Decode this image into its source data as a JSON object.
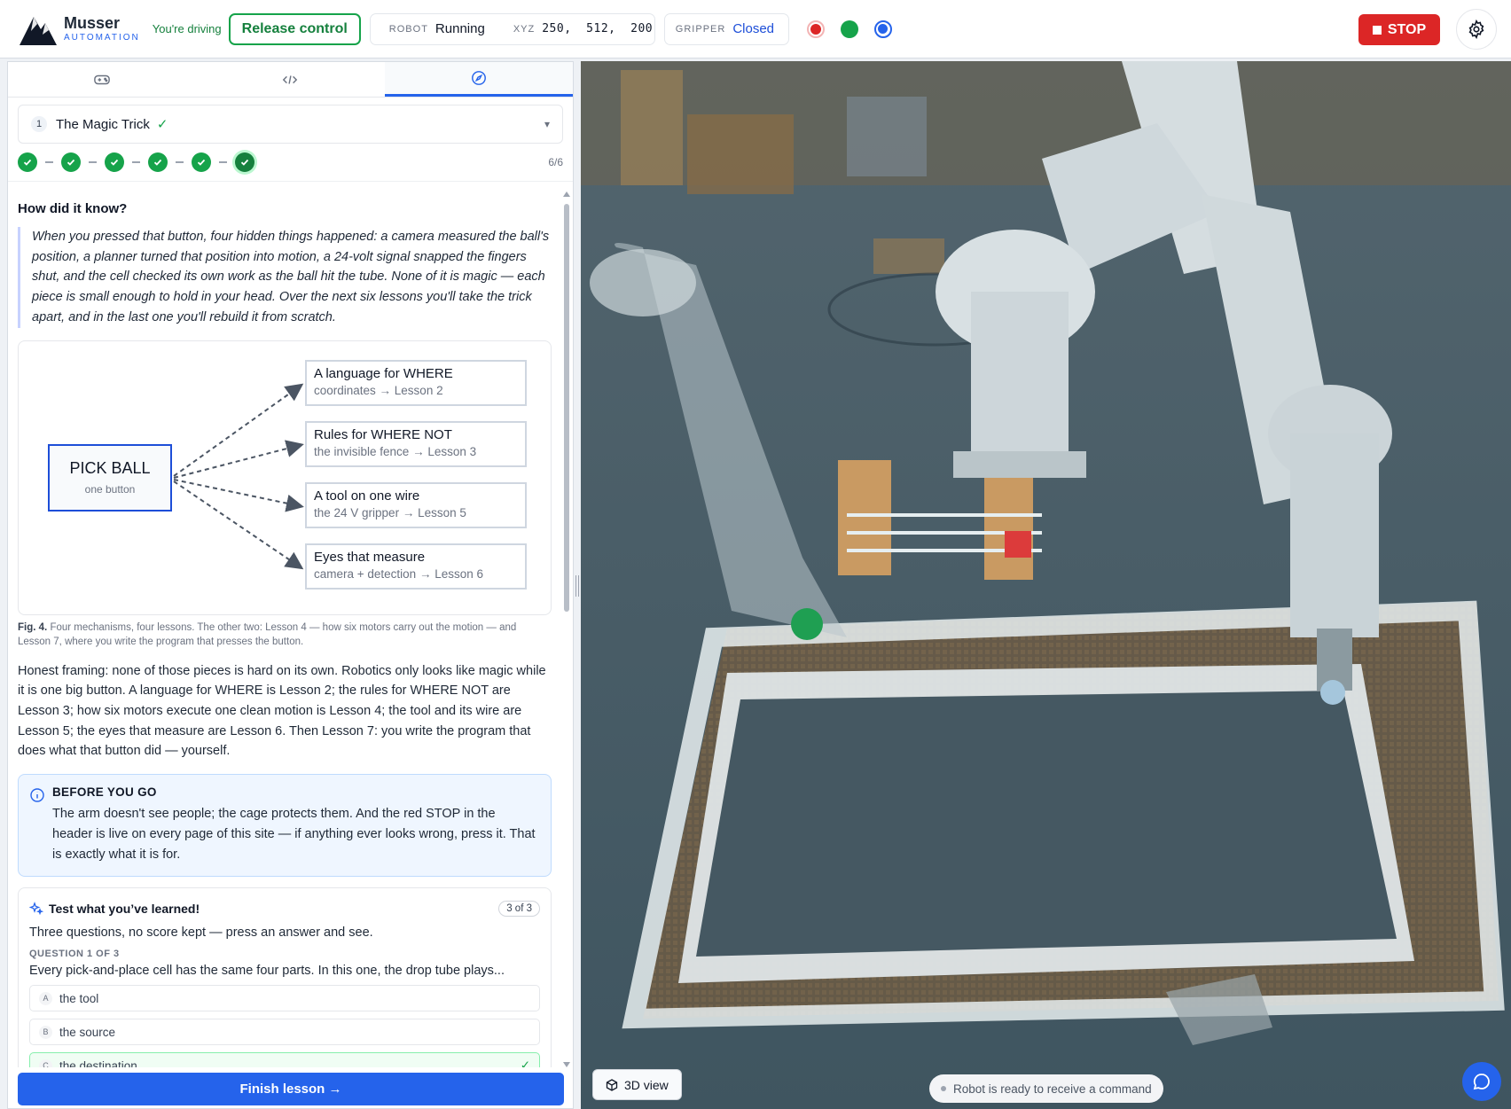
{
  "header": {
    "brand_name": "Musser",
    "brand_sub": "AUTOMATION",
    "driving_text": "You're driving",
    "release_label": "Release control",
    "robot_label": "ROBOT",
    "robot_state": "Running",
    "xyz_label": "XYZ",
    "xyz_value": "250,  512,  200",
    "gripper_label": "GRIPPER",
    "gripper_state": "Closed",
    "indicators": [
      "record-icon",
      "status-green-icon",
      "camera-blue-icon"
    ],
    "stop_label": "STOP",
    "colors": {
      "stop": "#dc2626",
      "running": "#16a34a",
      "accent": "#2563eb"
    }
  },
  "tabs": [
    {
      "icon": "gamepad-icon",
      "active": false
    },
    {
      "icon": "code-icon",
      "active": false
    },
    {
      "icon": "compass-icon",
      "active": true
    }
  ],
  "lesson": {
    "number": "1",
    "title": "The Magic Trick",
    "steps_total": 6,
    "steps_done": 6,
    "progress_text": "6/6"
  },
  "content": {
    "heading": "How did it know?",
    "quote": "When you pressed that button, four hidden things happened: a camera measured the ball's position, a planner turned that position into motion, a 24-volt signal snapped the fingers shut, and the cell checked its own work as the ball hit the tube. None of it is magic — each piece is small enough to hold in your head. Over the next six lessons you'll take the trick apart, and in the last one you'll rebuild it from scratch.",
    "figure": {
      "main_title": "PICK BALL",
      "main_sub": "one button",
      "nodes": [
        {
          "title": "A language for WHERE",
          "sub": "coordinates → Lesson 2"
        },
        {
          "title": "Rules for WHERE NOT",
          "sub": "the invisible fence → Lesson 3"
        },
        {
          "title": "A tool on one wire",
          "sub": "the 24 V gripper → Lesson 5"
        },
        {
          "title": "Eyes that measure",
          "sub": "camera + detection → Lesson 6"
        }
      ],
      "caption_label": "Fig. 4.",
      "caption_text": "Four mechanisms, four lessons. The other two: Lesson 4 — how six motors carry out the motion — and Lesson 7, where you write the program that presses the button."
    },
    "body": "Honest framing: none of those pieces is hard on its own. Robotics only looks like magic while it is one big button. A language for WHERE is Lesson 2; the rules for WHERE NOT are Lesson 3; how six motors execute one clean motion is Lesson 4; the tool and its wire are Lesson 5; the eyes that measure are Lesson 6. Then Lesson 7: you write the program that does what that button did — yourself.",
    "callout": {
      "title": "BEFORE YOU GO",
      "text": "The arm doesn't see people; the cage protects them. And the red STOP in the header is live on every page of this site — if anything ever looks wrong, press it. That is exactly what it is for."
    },
    "quiz": {
      "title": "Test what you’ve learned!",
      "count": "3 of 3",
      "intro": "Three questions, no score kept — press an answer and see.",
      "question_label": "QUESTION 1 OF 3",
      "question": "Every pick-and-place cell has the same four parts. In this one, the drop tube plays...",
      "options": [
        {
          "key": "A",
          "label": "the tool"
        },
        {
          "key": "B",
          "label": "the source"
        },
        {
          "key": "C",
          "label": "the destination"
        }
      ]
    }
  },
  "finish_label": "Finish lesson →",
  "camera": {
    "view_label": "3D view",
    "status": "Robot is ready to receive a command"
  }
}
